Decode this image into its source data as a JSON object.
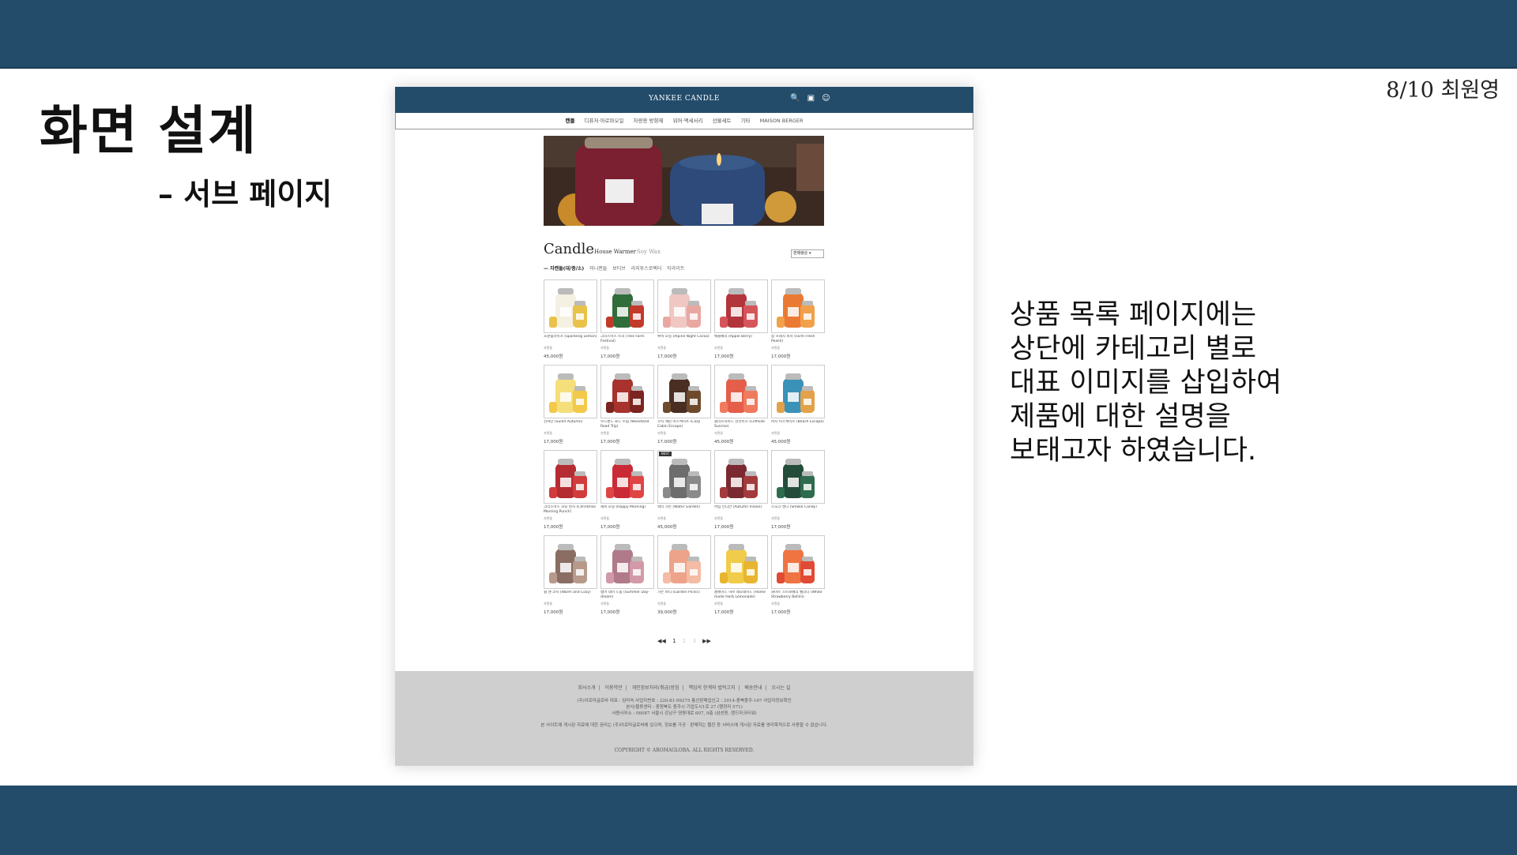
{
  "slide": {
    "page_label": "8/10 최원영",
    "title": "화면 설계",
    "subtitle": "– 서브 페이지",
    "description_lines": [
      "상품 목록 페이지에는",
      "상단에 카테고리 별로",
      "대표 이미지를 삽입하여",
      "제품에 대한 설명을",
      "보태고자 하였습니다."
    ]
  },
  "colors": {
    "band": "#234c6b",
    "footer": "#cfcfcf"
  },
  "mockup": {
    "logo": "YANKEE CANDLE",
    "icons": [
      "search-icon",
      "cart-icon",
      "user-icon"
    ],
    "nav": [
      "캔들",
      "디퓨저·아로마오일",
      "차량용 방향제",
      "워머·액세서리",
      "선물세트",
      "기타",
      "MAISON BERGER"
    ],
    "section_title": "Candle",
    "sub_tabs": [
      "House Warmer",
      "Soy Wax"
    ],
    "sort_label": "판매량순 ▾",
    "filters": [
      "— 자캔들(대/중/소)",
      "미니캔들",
      "보티브",
      "라지투스로렉터",
      "티라이트"
    ],
    "products": [
      {
        "name": "초원빛라이프 (Sparkling Lemon)",
        "cat": "자캔들",
        "price": "45,000원",
        "c1": "#f5f1e2",
        "c2": "#e8c24a"
      },
      {
        "name": "크리스마스 트리 (Tree Farm Festival)",
        "cat": "자캔들",
        "price": "17,000원",
        "c1": "#2f6d3a",
        "c2": "#c23a2a"
      },
      {
        "name": "루비 모닝 (Alpine Night Cocoa)",
        "cat": "자캔들",
        "price": "17,000원",
        "c1": "#f0c7c2",
        "c2": "#e9a7a1"
      },
      {
        "name": "애플베리 (Apple Berry)",
        "cat": "자캔들",
        "price": "17,000원",
        "c1": "#b2353b",
        "c2": "#d5555a"
      },
      {
        "name": "팜 프레시 피치 (Farm Fresh Peach)",
        "cat": "자캔들",
        "price": "17,000원",
        "c1": "#ea7a33",
        "c2": "#f2a04a"
      },
      {
        "name": "선샤인 (Sunlit Autumn)",
        "cat": "자캔들",
        "price": "17,000원",
        "c1": "#f4df7a",
        "c2": "#f2c94a"
      },
      {
        "name": "우드랜드 로드 트립 (Woodland Road Trip)",
        "cat": "자캔들",
        "price": "17,000원",
        "c1": "#a8322c",
        "c2": "#7b2420"
      },
      {
        "name": "코지 캐빈 이스케이프 (Cozy Cabin Escape)",
        "cat": "자캔들",
        "price": "17,000원",
        "c1": "#4a2e22",
        "c2": "#6e4a2c"
      },
      {
        "name": "클리프사이드 선라이즈 (Cliffside Sunrise)",
        "cat": "자캔들",
        "price": "45,000원",
        "c1": "#e45e4a",
        "c2": "#f07a5e"
      },
      {
        "name": "비치 이스케이프 (Beach Escape)",
        "cat": "자캔들",
        "price": "45,000원",
        "c1": "#3a92b8",
        "c2": "#e3a24a"
      },
      {
        "name": "크리스마스 모닝 펀치 (Christmas Morning Punch)",
        "cat": "자캔들",
        "price": "17,000원",
        "c1": "#b52b32",
        "c2": "#d23c3c"
      },
      {
        "name": "해피 모닝 (Happy Morning)",
        "cat": "자캔들",
        "price": "17,000원",
        "c1": "#c92a35",
        "c2": "#e04545"
      },
      {
        "name": "워터 가든 (Water Garden)",
        "cat": "자캔들",
        "price": "45,000원",
        "c1": "#6d6d6d",
        "c2": "#8a8a8a",
        "badge": "BEST"
      },
      {
        "name": "어텀 인디안 (Autumn Indian)",
        "cat": "자캔들",
        "price": "17,000원",
        "c1": "#7a2a30",
        "c2": "#a33a3c"
      },
      {
        "name": "스모크 캔디 (Smoke Candy)",
        "cat": "자캔들",
        "price": "17,000원",
        "c1": "#244c3a",
        "c2": "#2f6b4e"
      },
      {
        "name": "웜 앤 코지 (Warm and Cozy)",
        "cat": "자캔들",
        "price": "17,000원",
        "c1": "#8a6e63",
        "c2": "#b79a8c"
      },
      {
        "name": "썸머 데이 드림 (Summer Day-dream)",
        "cat": "자캔들",
        "price": "17,000원",
        "c1": "#b07a8a",
        "c2": "#d29aa8"
      },
      {
        "name": "가든 파티 (Garden Picnic)",
        "cat": "자캔들",
        "price": "39,000원",
        "c1": "#eda38a",
        "c2": "#f4bca4"
      },
      {
        "name": "홈메이드 허브 레모네이드 (Home made Herb Lemonade)",
        "cat": "자캔들",
        "price": "17,000원",
        "c1": "#f0cc4a",
        "c2": "#e8b530"
      },
      {
        "name": "화이트 스트로베리 벨리니 (White Strawberry Bellini)",
        "cat": "자캔들",
        "price": "17,000원",
        "c1": "#ef7442",
        "c2": "#e14a34"
      }
    ],
    "pagination": [
      "◀◀",
      "1",
      "2",
      "3",
      "▶▶"
    ],
    "footer": {
      "links": [
        "회사소개",
        "이용약관",
        "개인정보처리(취급)방침",
        "책임의 한계와 법적고지",
        "배송안내",
        "오시는 길"
      ],
      "info_lines": [
        "(주)아로마글로바  대표 : 임미숙   사업자번호 : 220-81-99275   통신판매업신고 : 2014-충북충주-167   사업자정보확인",
        "본사/물류센터 : 충청북도 충주시 기업도시1로 27 (행정리 571)",
        "사용사무소 : 06087 서울시 강남구 영동대로 607, 9층 (삼성동, 랜드마크타워)"
      ],
      "notice": "본 사이트에 게시된 자료에 대한 권리는 (주)아로마글로바에 있으며, 정보를 가공 · 판매하는 웹진 등 서비스에 게시된 자료를 영리목적으로 사용할 수 없습니다.",
      "copyright": "COPYRIGHT © AROMAGLOBA. ALL RIGHTS RESERVED."
    }
  }
}
